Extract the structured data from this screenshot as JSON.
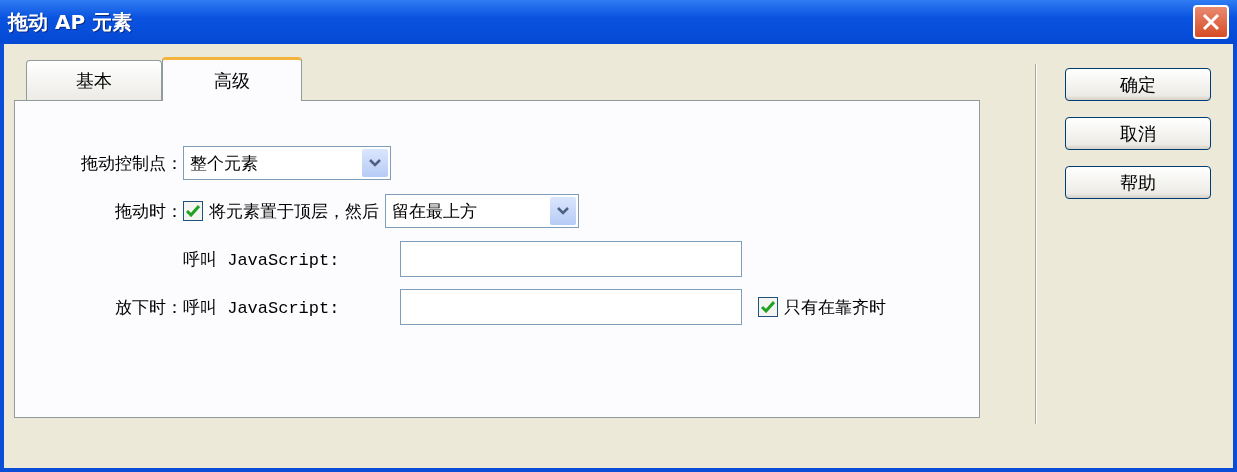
{
  "window": {
    "title": "拖动 AP 元素"
  },
  "tabs": [
    {
      "label": "基本",
      "selected": false
    },
    {
      "label": "高级",
      "selected": true
    }
  ],
  "drag_handle": {
    "label": "拖动控制点：",
    "value": "整个元素"
  },
  "while_dragging": {
    "label": "拖动时：",
    "checkbox": {
      "label": "将元素置于顶层，然后",
      "checked": true
    },
    "select_value": "留在最上方",
    "call_label": "呼叫 JavaScript:"
  },
  "when_dropped": {
    "label": "放下时：",
    "call_label": "呼叫 JavaScript:",
    "checkbox": {
      "label": "只有在靠齐时",
      "checked": true
    }
  },
  "buttons": [
    "确定",
    "取消",
    "帮助"
  ]
}
